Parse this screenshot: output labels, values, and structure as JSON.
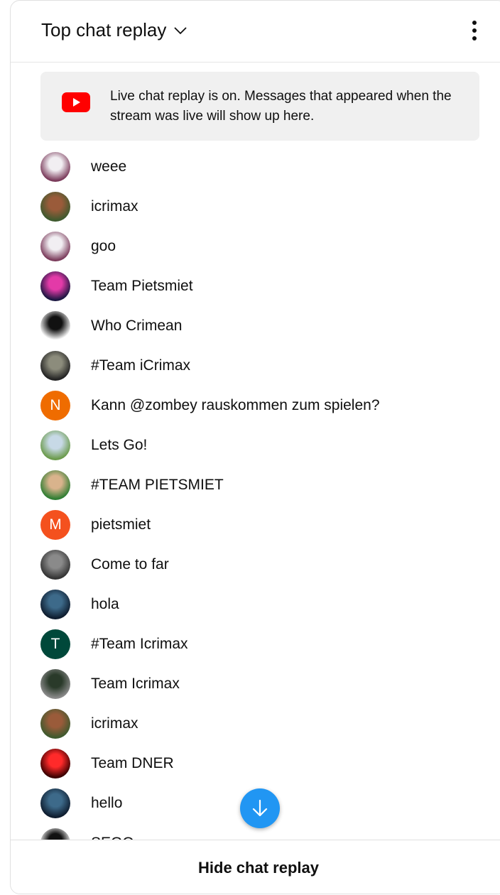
{
  "header": {
    "title": "Top chat replay",
    "dropdown_icon": "chevron-down-icon",
    "menu_icon": "more-vert-icon"
  },
  "banner": {
    "icon": "youtube-logo",
    "text": "Live chat replay is on. Messages that appeared when the stream was live will show up here."
  },
  "messages": [
    {
      "text": "weee",
      "avatar": {
        "type": "image",
        "colors": [
          "#7a3a5a",
          "#f1eef2"
        ]
      }
    },
    {
      "text": "icrimax",
      "avatar": {
        "type": "image",
        "colors": [
          "#3e5a2e",
          "#9a5b3a"
        ]
      }
    },
    {
      "text": "goo",
      "avatar": {
        "type": "image",
        "colors": [
          "#7a3a5a",
          "#f1eef2"
        ]
      }
    },
    {
      "text": "Team Pietsmiet",
      "avatar": {
        "type": "image",
        "colors": [
          "#1a1640",
          "#e33aa8"
        ]
      }
    },
    {
      "text": "Who Crimean",
      "avatar": {
        "type": "image",
        "colors": [
          "#ffffff",
          "#111111"
        ]
      }
    },
    {
      "text": "#Team iCrimax",
      "avatar": {
        "type": "image",
        "colors": [
          "#222222",
          "#8c8c7c"
        ]
      }
    },
    {
      "text": "Kann @zombey rauskommen zum spielen?",
      "avatar": {
        "type": "letter",
        "letter": "N",
        "color": "#ef6c00"
      }
    },
    {
      "text": "Lets Go!",
      "avatar": {
        "type": "image",
        "colors": [
          "#6a9a4a",
          "#c7d9e6"
        ]
      }
    },
    {
      "text": "#TEAM PIETSMIET",
      "avatar": {
        "type": "image",
        "colors": [
          "#2e7d32",
          "#d9b38c"
        ]
      }
    },
    {
      "text": "pietsmiet",
      "avatar": {
        "type": "letter",
        "letter": "M",
        "color": "#f4511e"
      }
    },
    {
      "text": "Come to far",
      "avatar": {
        "type": "image",
        "colors": [
          "#333333",
          "#8a8a8a"
        ]
      }
    },
    {
      "text": "hola",
      "avatar": {
        "type": "image",
        "colors": [
          "#0e1c2e",
          "#3d6a8a"
        ]
      }
    },
    {
      "text": "#Team Icrimax",
      "avatar": {
        "type": "letter",
        "letter": "T",
        "color": "#00483a"
      }
    },
    {
      "text": "Team Icrimax",
      "avatar": {
        "type": "image",
        "colors": [
          "#8a8a8a",
          "#2a3a2a"
        ]
      }
    },
    {
      "text": "icrimax",
      "avatar": {
        "type": "image",
        "colors": [
          "#3e5a2e",
          "#9a5b3a"
        ]
      }
    },
    {
      "text": "Team DNER",
      "avatar": {
        "type": "image",
        "colors": [
          "#3a0000",
          "#ff2a2a"
        ]
      }
    },
    {
      "text": "hello",
      "avatar": {
        "type": "image",
        "colors": [
          "#0e1c2e",
          "#3d6a8a"
        ]
      }
    },
    {
      "text": "SEGO",
      "avatar": {
        "type": "image",
        "colors": [
          "#ffffff",
          "#111111"
        ]
      }
    }
  ],
  "scroll_button": {
    "icon": "arrow-down-icon",
    "color": "#2196f3"
  },
  "footer": {
    "hide_label": "Hide chat replay"
  }
}
